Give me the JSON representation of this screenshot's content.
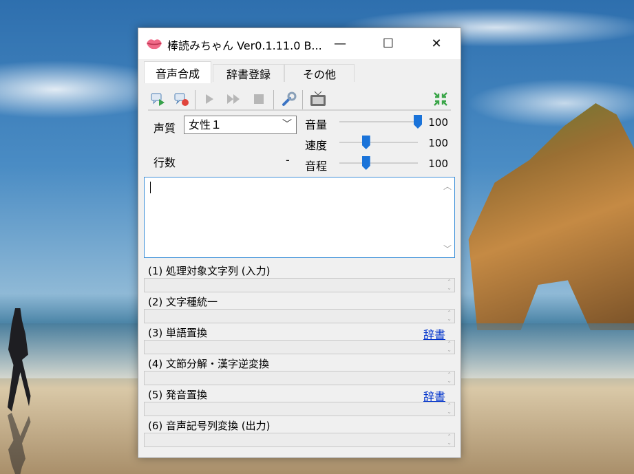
{
  "window": {
    "title": "棒読みちゃん Ver0.1.11.0 B...",
    "controls": {
      "minimize": "—",
      "maximize": "☐",
      "close": "✕"
    }
  },
  "tabs": [
    {
      "label": "音声合成",
      "active": true
    },
    {
      "label": "辞書登録",
      "active": false
    },
    {
      "label": "その他",
      "active": false
    }
  ],
  "toolbar": {
    "icons": [
      "speech-play-icon",
      "speech-stop-icon",
      "play-icon",
      "skip-icon",
      "stop-icon",
      "wrench-icon",
      "tv-icon",
      "collapse-arrows-icon"
    ]
  },
  "voice": {
    "label": "声質",
    "selected": "女性１"
  },
  "lines": {
    "label": "行数",
    "value": "-"
  },
  "params": [
    {
      "label": "音量",
      "value": "100",
      "level": 1.0
    },
    {
      "label": "速度",
      "value": "100",
      "level": 0.34
    },
    {
      "label": "音程",
      "value": "100",
      "level": 0.34
    }
  ],
  "stages": [
    {
      "label": "(1) 処理対象文字列 (入力)",
      "link": ""
    },
    {
      "label": "(2) 文字種統一",
      "link": ""
    },
    {
      "label": "(3) 単語置換",
      "link": "辞書"
    },
    {
      "label": "(4) 文節分解・漢字逆変換",
      "link": ""
    },
    {
      "label": "(5) 発音置換",
      "link": "辞書"
    },
    {
      "label": "(6) 音声記号列変換 (出力)",
      "link": ""
    }
  ],
  "colors": {
    "accent": "#1a73d9",
    "link": "#0033cc"
  }
}
